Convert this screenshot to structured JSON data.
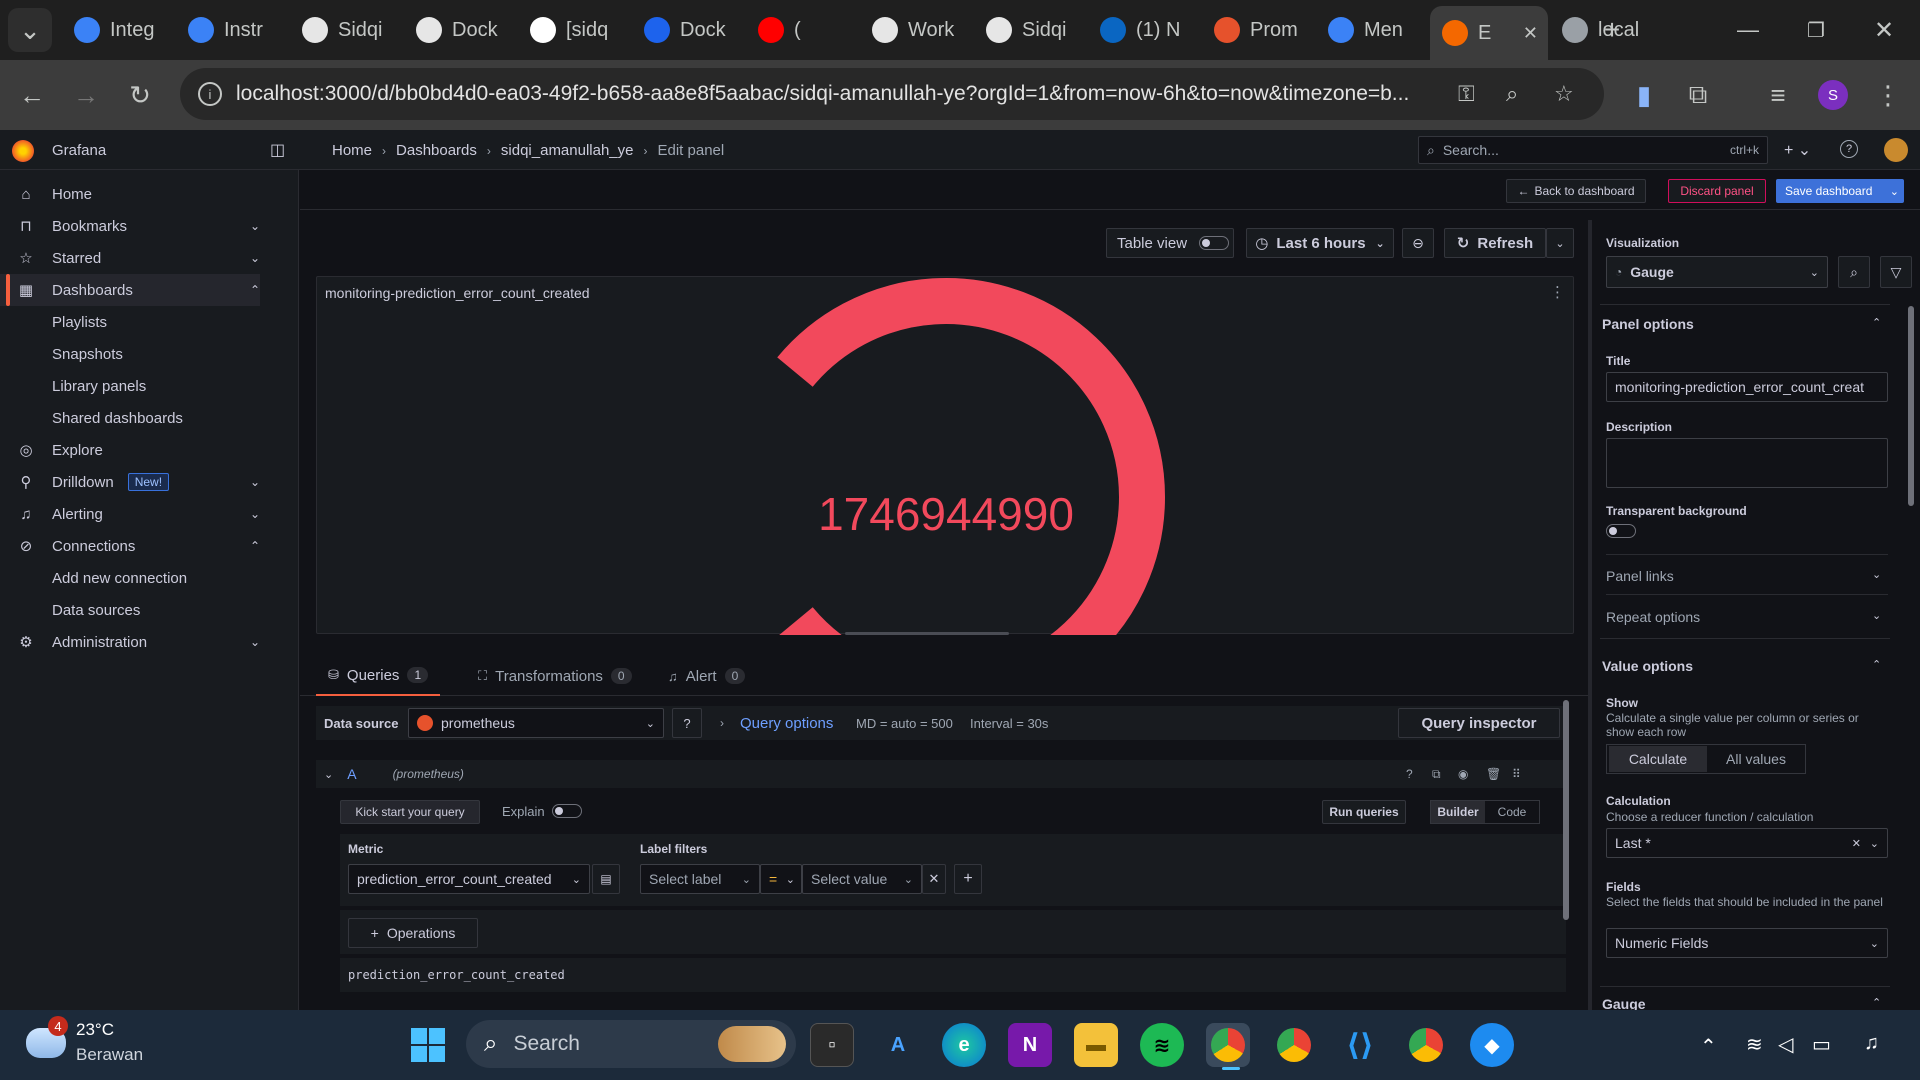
{
  "browser": {
    "tabs": [
      {
        "label": "Integ",
        "icon": "grafana-icon"
      },
      {
        "label": "Instr",
        "icon": "grafana-icon"
      },
      {
        "label": "Sidqi",
        "icon": "github-cat-icon"
      },
      {
        "label": "Dock",
        "icon": "openai-icon"
      },
      {
        "label": "[sidq",
        "icon": "google-icon"
      },
      {
        "label": "Dock",
        "icon": "docker-icon"
      },
      {
        "label": "(",
        "icon": "youtube-icon"
      },
      {
        "label": "Work",
        "icon": "github-icon"
      },
      {
        "label": "Sidqi",
        "icon": "github-icon"
      },
      {
        "label": "(1) N",
        "icon": "linkedin-icon"
      },
      {
        "label": "Prom",
        "icon": "prometheus-icon"
      },
      {
        "label": "Men",
        "icon": "grafana-icon"
      },
      {
        "label": "E",
        "icon": "grafana-orange-icon",
        "active": true
      },
      {
        "label": "local",
        "icon": "globe-icon"
      }
    ],
    "url": "localhost:3000/d/bb0bd4d0-ea03-49f2-b658-aa8e8f5aabac/sidqi-amanullah-ye?orgId=1&from=now-6h&to=now&timezone=b...",
    "profile_initial": "S"
  },
  "grafana": {
    "brand": "Grafana",
    "breadcrumb": [
      "Home",
      "Dashboards",
      "sidqi_amanullah_ye",
      "Edit panel"
    ],
    "search_placeholder": "Search...",
    "search_shortcut": "ctrl+k",
    "nav": [
      {
        "label": "Home",
        "icon": "home-icon"
      },
      {
        "label": "Bookmarks",
        "icon": "bookmark-icon",
        "chevron": "down"
      },
      {
        "label": "Starred",
        "icon": "star-icon",
        "chevron": "down"
      },
      {
        "label": "Dashboards",
        "icon": "grid-icon",
        "chevron": "up",
        "active": true
      },
      {
        "label": "Explore",
        "icon": "compass-icon"
      },
      {
        "label": "Drilldown",
        "icon": "drilldown-icon",
        "chevron": "down",
        "badge": "New!"
      },
      {
        "label": "Alerting",
        "icon": "bell-icon",
        "chevron": "down"
      },
      {
        "label": "Connections",
        "icon": "connections-icon",
        "chevron": "up"
      },
      {
        "label": "Administration",
        "icon": "gear-icon",
        "chevron": "down"
      }
    ],
    "dash_sub": [
      "Playlists",
      "Snapshots",
      "Library panels",
      "Shared dashboards"
    ],
    "conn_sub": [
      "Add new connection",
      "Data sources"
    ],
    "actions": {
      "back": "Back to dashboard",
      "discard": "Discard panel",
      "save": "Save dashboard"
    },
    "toolbar": {
      "table_view": "Table view",
      "time_range": "Last 6 hours",
      "refresh": "Refresh"
    },
    "panel": {
      "title": "monitoring-prediction_error_count_created",
      "value": "1746944990",
      "value_color": "#f2495c",
      "gauge_fraction": 1.0
    },
    "tabs": [
      {
        "label": "Queries",
        "count": "1"
      },
      {
        "label": "Transformations",
        "count": "0"
      },
      {
        "label": "Alert",
        "count": "0"
      }
    ],
    "query": {
      "ds_label": "Data source",
      "datasource": "prometheus",
      "query_options": "Query options",
      "md": "MD = auto = 500",
      "interval": "Interval = 30s",
      "inspector": "Query inspector",
      "ref": "A",
      "ref_ds": "(prometheus)",
      "kick_start": "Kick start your query",
      "explain": "Explain",
      "run": "Run queries",
      "builder": "Builder",
      "code": "Code",
      "metric_label": "Metric",
      "metric": "prediction_error_count_created",
      "label_filters": "Label filters",
      "select_label": "Select label",
      "operator": "=",
      "select_value": "Select value",
      "operations": "Operations",
      "preview": "prediction_error_count_created"
    },
    "options": {
      "viz_label": "Visualization",
      "viz": "Gauge",
      "panel_options": "Panel options",
      "title_label": "Title",
      "title_value": "monitoring-prediction_error_count_creat",
      "description_label": "Description",
      "transparent_label": "Transparent background",
      "panel_links": "Panel links",
      "repeat_options": "Repeat options",
      "value_options": "Value options",
      "show_label": "Show",
      "show_desc": "Calculate a single value per column or series or show each row",
      "calculate": "Calculate",
      "all_values": "All values",
      "calc_label": "Calculation",
      "calc_desc": "Choose a reducer function / calculation",
      "calc_value": "Last *",
      "fields_label": "Fields",
      "fields_desc": "Select the fields that should be included in the panel",
      "fields_value": "Numeric Fields",
      "gauge_section": "Gauge"
    }
  },
  "taskbar": {
    "weather_temp": "23°C",
    "weather_desc": "Berawan",
    "weather_badge": "4",
    "search": "Search"
  }
}
